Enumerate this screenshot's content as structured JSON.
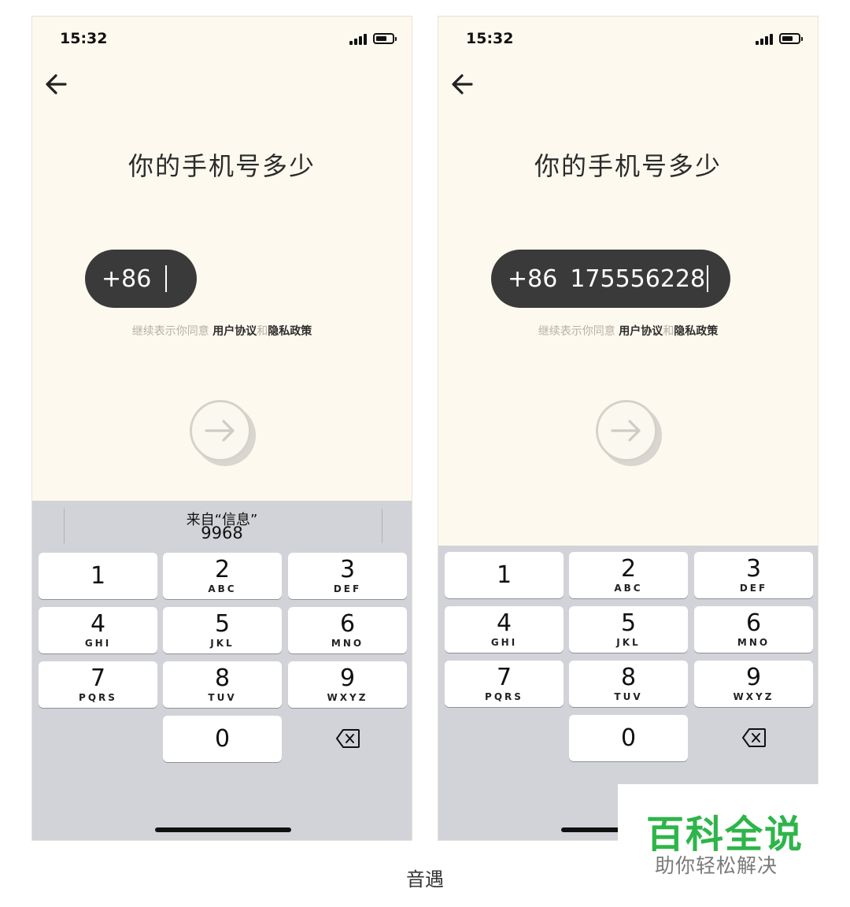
{
  "screens": [
    {
      "time": "15:32",
      "title": "你的手机号多少",
      "country_code": "+86",
      "phone_number": "",
      "agreement": {
        "prefix": "继续表示你同意 ",
        "terms": "用户协议",
        "and": "和",
        "privacy": "隐私政策"
      },
      "keyboard_suggestion": {
        "source": "来自“信息”",
        "code": "9968"
      }
    },
    {
      "time": "15:32",
      "title": "你的手机号多少",
      "country_code": "+86",
      "phone_number": "175556228",
      "agreement": {
        "prefix": "继续表示你同意 ",
        "terms": "用户协议",
        "and": "和",
        "privacy": "隐私政策"
      }
    }
  ],
  "keypad": {
    "keys": [
      {
        "num": "1",
        "letters": ""
      },
      {
        "num": "2",
        "letters": "ABC"
      },
      {
        "num": "3",
        "letters": "DEF"
      },
      {
        "num": "4",
        "letters": "GHI"
      },
      {
        "num": "5",
        "letters": "JKL"
      },
      {
        "num": "6",
        "letters": "MNO"
      },
      {
        "num": "7",
        "letters": "PQRS"
      },
      {
        "num": "8",
        "letters": "TUV"
      },
      {
        "num": "9",
        "letters": "WXYZ"
      },
      {
        "num": "0",
        "letters": ""
      }
    ]
  },
  "icons": {
    "back": "arrow-left-icon",
    "next": "arrow-right-icon",
    "delete": "backspace-icon",
    "signal": "signal-icon",
    "battery": "battery-icon"
  },
  "caption": "音遇",
  "watermark": {
    "title": "百科全说",
    "subtitle": "助你轻松解决"
  },
  "colors": {
    "screen_background": "#fdf9ee",
    "input_pill": "#3a3a3a",
    "keyboard_background": "#d2d3d8",
    "watermark_green": "#2eb54a"
  }
}
